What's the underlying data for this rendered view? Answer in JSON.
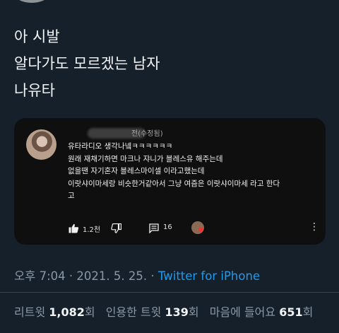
{
  "tweet": {
    "lines": [
      "아 시발",
      "알다가도 모르겠는 남자",
      "나유타"
    ]
  },
  "comment": {
    "meta": "전(수정됨)",
    "lines": [
      "유타라디오 생각나넼ㅋㅋㅋㅋㅋㅋ",
      "원래 재채기하면 마크나 쟈니가 블레스유 해주는데",
      "없을땐 자기혼자 블레스마이셀 이라고했는데",
      "이랏샤이마세랑 비슷한거같아서 그냥 여즘은 이랏샤이마세 라고 한다",
      "고"
    ],
    "likes": "1.2천",
    "replies": "16",
    "icons": {
      "like": "thumbs-up-icon",
      "dislike": "thumbs-down-icon",
      "reply": "comment-icon",
      "more": "more-vertical-icon",
      "heart": "heart-icon"
    },
    "heart_color": "#ff2d2d"
  },
  "meta": {
    "time": "오후 7:04",
    "sep1": " · ",
    "date": "2021. 5. 25.",
    "sep2": " · ",
    "source": "Twitter for iPhone"
  },
  "stats": {
    "retweets_label": "리트윗",
    "retweets": "1,082",
    "retweets_unit": "회",
    "quotes_label": "인용한 트윗",
    "quotes": "139",
    "quotes_unit": "회",
    "likes_label": "마음에 들어요",
    "likes": "651",
    "likes_unit": "회"
  },
  "colors": {
    "background": "#15202b",
    "link": "#1d9bf0",
    "muted": "#8b98a5"
  }
}
